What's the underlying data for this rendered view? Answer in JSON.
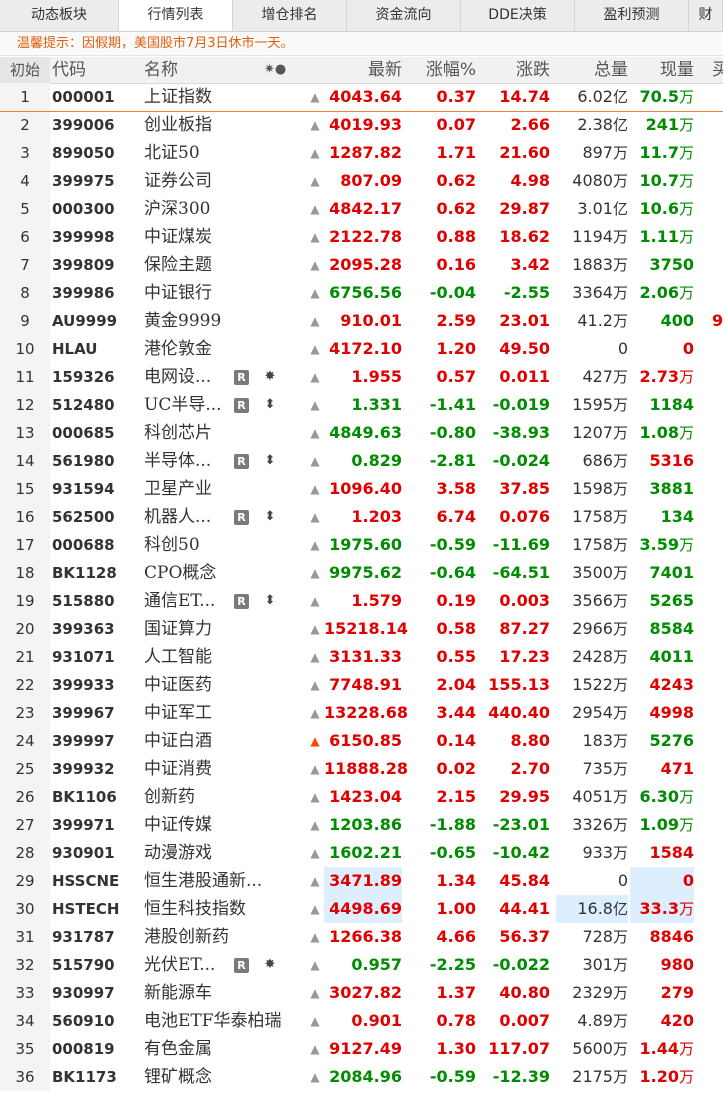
{
  "tabs": [
    "动态板块",
    "行情列表",
    "增仓排名",
    "资金流向",
    "DDE决策",
    "盈利预测",
    "财"
  ],
  "notice": "温馨提示：因假期，美国股市7月3日休市一天。",
  "headers": {
    "idx": "初始",
    "code": "代码",
    "name": "名称",
    "sym": "✷●",
    "last": "最新",
    "pct": "涨幅%",
    "chg": "涨跌",
    "vol": "总量",
    "cur": "现量",
    "extra": "买"
  },
  "colors": {
    "up": "#e00000",
    "down": "#008c00",
    "accent": "#e06010",
    "highlight": "#ddeeff"
  },
  "rows": [
    {
      "idx": "1",
      "code": "000001",
      "name": "上证指数",
      "last": "4043.64",
      "pct": "0.37",
      "chg": "14.74",
      "vol": "6.02",
      "vol_unit": "亿",
      "cur": "70.5",
      "cur_unit": "万",
      "dir": "up",
      "cur_dir": "dn"
    },
    {
      "idx": "2",
      "code": "399006",
      "name": "创业板指",
      "last": "4019.93",
      "pct": "0.07",
      "chg": "2.66",
      "vol": "2.38",
      "vol_unit": "亿",
      "cur": "241",
      "cur_unit": "万",
      "dir": "up",
      "cur_dir": "dn"
    },
    {
      "idx": "3",
      "code": "899050",
      "name": "北证50",
      "last": "1287.82",
      "pct": "1.71",
      "chg": "21.60",
      "vol": "897",
      "vol_unit": "万",
      "cur": "11.7",
      "cur_unit": "万",
      "dir": "up",
      "cur_dir": "dn"
    },
    {
      "idx": "4",
      "code": "399975",
      "name": "证券公司",
      "last": "807.09",
      "pct": "0.62",
      "chg": "4.98",
      "vol": "4080",
      "vol_unit": "万",
      "cur": "10.7",
      "cur_unit": "万",
      "dir": "up",
      "cur_dir": "dn"
    },
    {
      "idx": "5",
      "code": "000300",
      "name": "沪深300",
      "last": "4842.17",
      "pct": "0.62",
      "chg": "29.87",
      "vol": "3.01",
      "vol_unit": "亿",
      "cur": "10.6",
      "cur_unit": "万",
      "dir": "up",
      "cur_dir": "dn"
    },
    {
      "idx": "6",
      "code": "399998",
      "name": "中证煤炭",
      "last": "2122.78",
      "pct": "0.88",
      "chg": "18.62",
      "vol": "1194",
      "vol_unit": "万",
      "cur": "1.11",
      "cur_unit": "万",
      "dir": "up",
      "cur_dir": "dn"
    },
    {
      "idx": "7",
      "code": "399809",
      "name": "保险主题",
      "last": "2095.28",
      "pct": "0.16",
      "chg": "3.42",
      "vol": "1883",
      "vol_unit": "万",
      "cur": "3750",
      "cur_unit": "",
      "dir": "up",
      "cur_dir": "dn"
    },
    {
      "idx": "8",
      "code": "399986",
      "name": "中证银行",
      "last": "6756.56",
      "pct": "-0.04",
      "chg": "-2.55",
      "vol": "3364",
      "vol_unit": "万",
      "cur": "2.06",
      "cur_unit": "万",
      "dir": "dn",
      "cur_dir": "dn"
    },
    {
      "idx": "9",
      "code": "AU9999",
      "name": "黄金9999",
      "last": "910.01",
      "pct": "2.59",
      "chg": "23.01",
      "vol": "41.2",
      "vol_unit": "万",
      "cur": "400",
      "cur_unit": "",
      "dir": "up",
      "cur_dir": "dn",
      "extra": "9"
    },
    {
      "idx": "10",
      "code": "HLAU",
      "name": "港伦敦金",
      "last": "4172.10",
      "pct": "1.20",
      "chg": "49.50",
      "vol": "0",
      "vol_unit": "",
      "cur": "0",
      "cur_unit": "",
      "dir": "up",
      "cur_dir": "up"
    },
    {
      "idx": "11",
      "code": "159326",
      "name": "电网设...",
      "badge": "R",
      "sym": "✸",
      "last": "1.955",
      "pct": "0.57",
      "chg": "0.011",
      "vol": "427",
      "vol_unit": "万",
      "cur": "2.73",
      "cur_unit": "万",
      "dir": "up",
      "cur_dir": "up"
    },
    {
      "idx": "12",
      "code": "512480",
      "name": "UC半导...",
      "badge": "R",
      "sym": "⬍",
      "last": "1.331",
      "pct": "-1.41",
      "chg": "-0.019",
      "vol": "1595",
      "vol_unit": "万",
      "cur": "1184",
      "cur_unit": "",
      "dir": "dn",
      "cur_dir": "dn"
    },
    {
      "idx": "13",
      "code": "000685",
      "name": "科创芯片",
      "last": "4849.63",
      "pct": "-0.80",
      "chg": "-38.93",
      "vol": "1207",
      "vol_unit": "万",
      "cur": "1.08",
      "cur_unit": "万",
      "dir": "dn",
      "cur_dir": "dn"
    },
    {
      "idx": "14",
      "code": "561980",
      "name": "半导体...",
      "badge": "R",
      "sym": "⬍",
      "last": "0.829",
      "pct": "-2.81",
      "chg": "-0.024",
      "vol": "686",
      "vol_unit": "万",
      "cur": "5316",
      "cur_unit": "",
      "dir": "dn",
      "cur_dir": "up"
    },
    {
      "idx": "15",
      "code": "931594",
      "name": "卫星产业",
      "last": "1096.40",
      "pct": "3.58",
      "chg": "37.85",
      "vol": "1598",
      "vol_unit": "万",
      "cur": "3881",
      "cur_unit": "",
      "dir": "up",
      "cur_dir": "dn"
    },
    {
      "idx": "16",
      "code": "562500",
      "name": "机器人...",
      "badge": "R",
      "sym": "⬍",
      "last": "1.203",
      "pct": "6.74",
      "chg": "0.076",
      "vol": "1758",
      "vol_unit": "万",
      "cur": "134",
      "cur_unit": "",
      "dir": "up",
      "cur_dir": "dn"
    },
    {
      "idx": "17",
      "code": "000688",
      "name": "科创50",
      "last": "1975.60",
      "pct": "-0.59",
      "chg": "-11.69",
      "vol": "1758",
      "vol_unit": "万",
      "cur": "3.59",
      "cur_unit": "万",
      "dir": "dn",
      "cur_dir": "dn"
    },
    {
      "idx": "18",
      "code": "BK1128",
      "name": "CPO概念",
      "last": "9975.62",
      "pct": "-0.64",
      "chg": "-64.51",
      "vol": "3500",
      "vol_unit": "万",
      "cur": "7401",
      "cur_unit": "",
      "dir": "dn",
      "cur_dir": "dn"
    },
    {
      "idx": "19",
      "code": "515880",
      "name": "通信ET...",
      "badge": "R",
      "sym": "⬍",
      "last": "1.579",
      "pct": "0.19",
      "chg": "0.003",
      "vol": "3566",
      "vol_unit": "万",
      "cur": "5265",
      "cur_unit": "",
      "dir": "up",
      "cur_dir": "dn"
    },
    {
      "idx": "20",
      "code": "399363",
      "name": "国证算力",
      "last": "15218.14",
      "pct": "0.58",
      "chg": "87.27",
      "vol": "2966",
      "vol_unit": "万",
      "cur": "8584",
      "cur_unit": "",
      "dir": "up",
      "cur_dir": "dn"
    },
    {
      "idx": "21",
      "code": "931071",
      "name": "人工智能",
      "last": "3131.33",
      "pct": "0.55",
      "chg": "17.23",
      "vol": "2428",
      "vol_unit": "万",
      "cur": "4011",
      "cur_unit": "",
      "dir": "up",
      "cur_dir": "dn"
    },
    {
      "idx": "22",
      "code": "399933",
      "name": "中证医药",
      "last": "7748.91",
      "pct": "2.04",
      "chg": "155.13",
      "vol": "1522",
      "vol_unit": "万",
      "cur": "4243",
      "cur_unit": "",
      "dir": "up",
      "cur_dir": "up"
    },
    {
      "idx": "23",
      "code": "399967",
      "name": "中证军工",
      "last": "13228.68",
      "pct": "3.44",
      "chg": "440.40",
      "vol": "2954",
      "vol_unit": "万",
      "cur": "4998",
      "cur_unit": "",
      "dir": "up",
      "cur_dir": "up"
    },
    {
      "idx": "24",
      "code": "399997",
      "name": "中证白酒",
      "hot": true,
      "last": "6150.85",
      "pct": "0.14",
      "chg": "8.80",
      "vol": "183",
      "vol_unit": "万",
      "cur": "5276",
      "cur_unit": "",
      "dir": "up",
      "cur_dir": "dn"
    },
    {
      "idx": "25",
      "code": "399932",
      "name": "中证消费",
      "last": "11888.28",
      "pct": "0.02",
      "chg": "2.70",
      "vol": "735",
      "vol_unit": "万",
      "cur": "471",
      "cur_unit": "",
      "dir": "up",
      "cur_dir": "up"
    },
    {
      "idx": "26",
      "code": "BK1106",
      "name": "创新药",
      "last": "1423.04",
      "pct": "2.15",
      "chg": "29.95",
      "vol": "4051",
      "vol_unit": "万",
      "cur": "6.30",
      "cur_unit": "万",
      "dir": "up",
      "cur_dir": "dn"
    },
    {
      "idx": "27",
      "code": "399971",
      "name": "中证传媒",
      "last": "1203.86",
      "pct": "-1.88",
      "chg": "-23.01",
      "vol": "3326",
      "vol_unit": "万",
      "cur": "1.09",
      "cur_unit": "万",
      "dir": "dn",
      "cur_dir": "dn"
    },
    {
      "idx": "28",
      "code": "930901",
      "name": "动漫游戏",
      "last": "1602.21",
      "pct": "-0.65",
      "chg": "-10.42",
      "vol": "933",
      "vol_unit": "万",
      "cur": "1584",
      "cur_unit": "",
      "dir": "dn",
      "cur_dir": "up"
    },
    {
      "idx": "29",
      "code": "HSSCNE",
      "name": "恒生港股通新...",
      "last": "3471.89",
      "pct": "1.34",
      "chg": "45.84",
      "vol": "0",
      "vol_unit": "",
      "cur": "0",
      "cur_unit": "",
      "dir": "up",
      "cur_dir": "up",
      "hl_last": true,
      "hl_cur": true
    },
    {
      "idx": "30",
      "code": "HSTECH",
      "name": "恒生科技指数",
      "last": "4498.69",
      "pct": "1.00",
      "chg": "44.41",
      "vol": "16.8",
      "vol_unit": "亿",
      "cur": "33.3",
      "cur_unit": "万",
      "dir": "up",
      "cur_dir": "up",
      "hl_last": true,
      "hl_vol": true,
      "hl_cur": true
    },
    {
      "idx": "31",
      "code": "931787",
      "name": "港股创新药",
      "last": "1266.38",
      "pct": "4.66",
      "chg": "56.37",
      "vol": "728",
      "vol_unit": "万",
      "cur": "8846",
      "cur_unit": "",
      "dir": "up",
      "cur_dir": "up"
    },
    {
      "idx": "32",
      "code": "515790",
      "name": "光伏ET...",
      "badge": "R",
      "sym": "✸",
      "last": "0.957",
      "pct": "-2.25",
      "chg": "-0.022",
      "vol": "301",
      "vol_unit": "万",
      "cur": "980",
      "cur_unit": "",
      "dir": "dn",
      "cur_dir": "up"
    },
    {
      "idx": "33",
      "code": "930997",
      "name": "新能源车",
      "last": "3027.82",
      "pct": "1.37",
      "chg": "40.80",
      "vol": "2329",
      "vol_unit": "万",
      "cur": "279",
      "cur_unit": "",
      "dir": "up",
      "cur_dir": "up"
    },
    {
      "idx": "34",
      "code": "560910",
      "name": "电池ETF华泰柏瑞",
      "last": "0.901",
      "pct": "0.78",
      "chg": "0.007",
      "vol": "4.89",
      "vol_unit": "万",
      "cur": "420",
      "cur_unit": "",
      "dir": "up",
      "cur_dir": "up"
    },
    {
      "idx": "35",
      "code": "000819",
      "name": "有色金属",
      "last": "9127.49",
      "pct": "1.30",
      "chg": "117.07",
      "vol": "5600",
      "vol_unit": "万",
      "cur": "1.44",
      "cur_unit": "万",
      "dir": "up",
      "cur_dir": "up"
    },
    {
      "idx": "36",
      "code": "BK1173",
      "name": "锂矿概念",
      "last": "2084.96",
      "pct": "-0.59",
      "chg": "-12.39",
      "vol": "2175",
      "vol_unit": "万",
      "cur": "1.20",
      "cur_unit": "万",
      "dir": "dn",
      "cur_dir": "up"
    }
  ]
}
